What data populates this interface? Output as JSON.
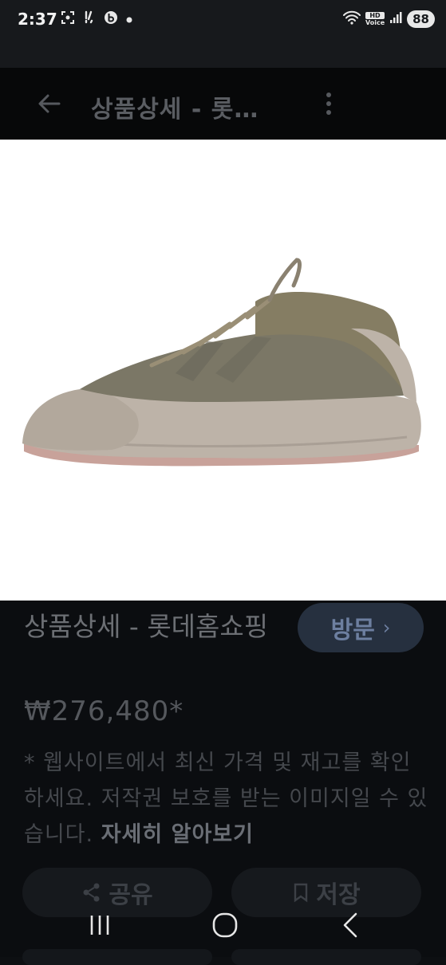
{
  "status_bar": {
    "time": "2:37",
    "left_icons": [
      "screenshot-icon",
      "notification-icon",
      "b-app-icon",
      "dot-icon"
    ],
    "hd_label": "HD",
    "voice_label": "Voice",
    "battery": "88"
  },
  "header": {
    "title": "상품상세 - 롯…"
  },
  "product": {
    "title": "상품상세 - 롯데홈쇼핑",
    "price": "₩276,480*",
    "notice": "* 웹사이트에서 최신 가격 및 재고를 확인하세요. 저작권 보호를 받는 이미지일 수 있습니다.",
    "more_link": "자세히 알아보기"
  },
  "actions": {
    "visit_label": "방문",
    "visit_chevron": "›",
    "share_label": "공유",
    "save_label": "저장"
  },
  "colors": {
    "accent_button": "#26303f",
    "background": "#0b0d10"
  }
}
